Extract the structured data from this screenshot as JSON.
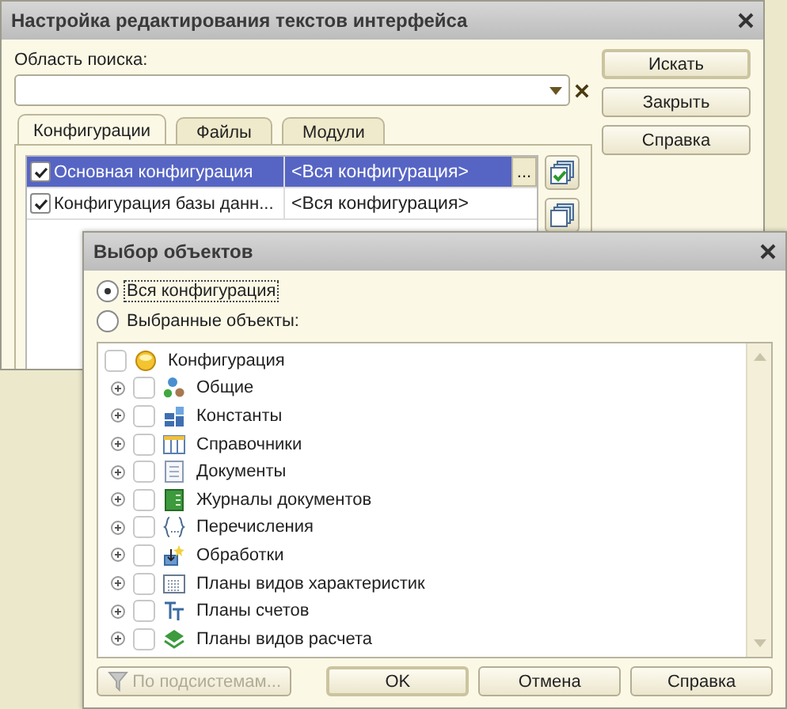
{
  "main_window": {
    "title": "Настройка редактирования текстов интерфейса",
    "search_label": "Область поиска:",
    "buttons": [
      {
        "label": "Искать",
        "default": true
      },
      {
        "label": "Закрыть",
        "default": false
      },
      {
        "label": "Справка",
        "default": false
      }
    ],
    "tabs": [
      {
        "label": "Конфигурации",
        "selected": true
      },
      {
        "label": "Файлы",
        "selected": false
      },
      {
        "label": "Модули",
        "selected": false
      }
    ],
    "rows": [
      {
        "name": "Основная конфигурация",
        "scope": "<Вся конфигурация>",
        "checked": true,
        "selected": true
      },
      {
        "name": "Конфигурация базы данн...",
        "scope": "<Вся конфигурация>",
        "checked": true,
        "selected": false
      }
    ],
    "edit_button": "..."
  },
  "dialog": {
    "title": "Выбор объектов",
    "radios": [
      {
        "label": "Вся конфигурация",
        "selected": true
      },
      {
        "label": "Выбранные объекты:",
        "selected": false
      }
    ],
    "tree": [
      {
        "label": "Конфигурация",
        "kind": "root",
        "checked": false,
        "children": [
          {
            "label": "Общие",
            "kind": "common",
            "checked": false,
            "expanded": false
          },
          {
            "label": "Константы",
            "kind": "constants",
            "checked": false,
            "expanded": false
          },
          {
            "label": "Справочники",
            "kind": "catalogs",
            "checked": false,
            "expanded": false
          },
          {
            "label": "Документы",
            "kind": "documents",
            "checked": false,
            "expanded": false
          },
          {
            "label": "Журналы документов",
            "kind": "journals",
            "checked": false,
            "expanded": false
          },
          {
            "label": "Перечисления",
            "kind": "enums",
            "checked": false,
            "expanded": false
          },
          {
            "label": "Обработки",
            "kind": "processors",
            "checked": false,
            "expanded": false
          },
          {
            "label": "Планы видов характеристик",
            "kind": "characteristics",
            "checked": false,
            "expanded": false
          },
          {
            "label": "Планы счетов",
            "kind": "accounts",
            "checked": false,
            "expanded": false
          },
          {
            "label": "Планы видов расчета",
            "kind": "calculations",
            "checked": false,
            "expanded": false
          }
        ]
      }
    ],
    "buttons": [
      {
        "label": "По подсистемам...",
        "kind": "filter",
        "disabled": true,
        "default": false
      },
      {
        "label": "OK",
        "kind": "plain",
        "disabled": false,
        "default": true
      },
      {
        "label": "Отмена",
        "kind": "plain",
        "disabled": false,
        "default": false
      },
      {
        "label": "Справка",
        "kind": "plain",
        "disabled": false,
        "default": false
      }
    ]
  }
}
